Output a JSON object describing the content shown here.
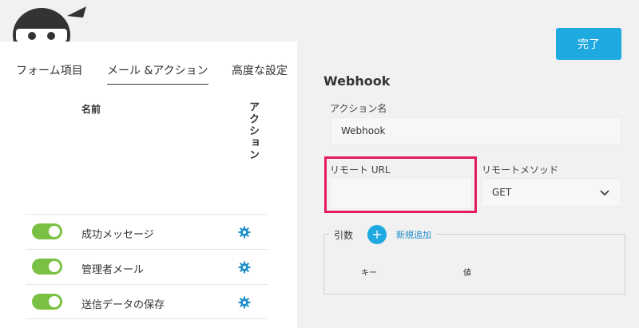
{
  "tabs": [
    {
      "label": "フォーム項目"
    },
    {
      "label": "メール &アクション"
    },
    {
      "label": "高度な設定"
    }
  ],
  "actions_table": {
    "col_name": "名前",
    "col_action": "アクション",
    "rows": [
      {
        "label": "成功メッセージ",
        "enabled": true
      },
      {
        "label": "管理者メール",
        "enabled": true
      },
      {
        "label": "送信データの保存",
        "enabled": true
      }
    ]
  },
  "done_button": "完了",
  "webhook": {
    "title": "Webhook",
    "action_name_label": "アクション名",
    "action_name_value": "Webhook",
    "remote_url_label": "リモート URL",
    "remote_url_value": "",
    "remote_method_label": "リモートメソッド",
    "remote_method_value": "GET",
    "params": {
      "legend": "引数",
      "add_label": "新規追加",
      "col_key": "キー",
      "col_value": "値"
    }
  },
  "colors": {
    "accent": "#1ea9e1",
    "toggle_on": "#7ac143",
    "highlight": "#e5195e"
  },
  "icons": [
    "ninja-logo-icon",
    "gear-icon",
    "chevron-down-icon",
    "plus-icon"
  ]
}
